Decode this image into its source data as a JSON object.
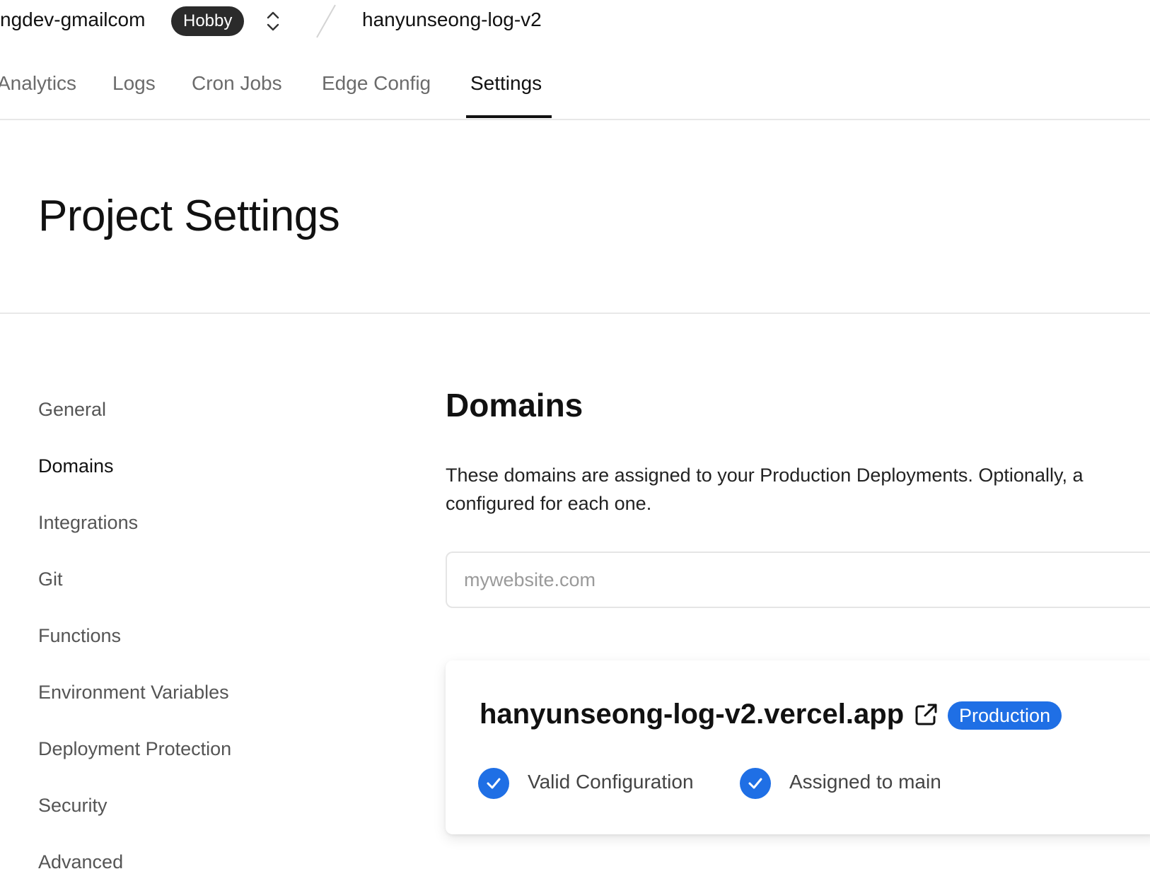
{
  "header": {
    "team_name": "ngdev-gmailcom",
    "plan_badge": "Hobby",
    "project_name": "hanyunseong-log-v2"
  },
  "tabs": [
    {
      "label": "Analytics"
    },
    {
      "label": "Logs"
    },
    {
      "label": "Cron Jobs"
    },
    {
      "label": "Edge Config"
    },
    {
      "label": "Settings",
      "active": true
    }
  ],
  "page": {
    "title": "Project Settings"
  },
  "sidebar": {
    "items": [
      {
        "label": "General"
      },
      {
        "label": "Domains",
        "active": true
      },
      {
        "label": "Integrations"
      },
      {
        "label": "Git"
      },
      {
        "label": "Functions"
      },
      {
        "label": "Environment Variables"
      },
      {
        "label": "Deployment Protection"
      },
      {
        "label": "Security"
      },
      {
        "label": "Advanced"
      }
    ]
  },
  "domains": {
    "title": "Domains",
    "description": "These domains are assigned to your Production Deployments. Optionally, a configured for each one.",
    "input": {
      "placeholder": "mywebsite.com",
      "value": ""
    },
    "card": {
      "domain": "hanyunseong-log-v2.vercel.app",
      "environment_badge": "Production",
      "statuses": [
        {
          "label": "Valid Configuration",
          "icon": "check-circle-icon"
        },
        {
          "label": "Assigned to main",
          "icon": "check-circle-icon"
        }
      ]
    }
  },
  "colors": {
    "accent_blue": "#1f6fe5",
    "badge_dark": "#2b2b2b",
    "text_primary": "#111111",
    "text_secondary": "#6b6b6b",
    "divider": "#e8e8e8"
  }
}
